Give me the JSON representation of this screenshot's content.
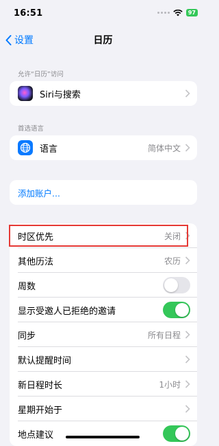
{
  "status": {
    "time": "16:51",
    "battery": "97",
    "battery_color": "#34c759"
  },
  "nav": {
    "back_label": "设置",
    "title": "日历",
    "accent": "#007aff"
  },
  "section_allow": {
    "header": "允许“日历”访问",
    "siri_label": "Siri与搜索"
  },
  "section_language": {
    "header": "首选语言",
    "language_label": "语言",
    "language_value": "简体中文"
  },
  "accounts": {
    "add_label": "添加账户..."
  },
  "settings": {
    "timezone": {
      "label": "时区优先",
      "value": "关闭"
    },
    "alt_calendar": {
      "label": "其他历法",
      "value": "农历"
    },
    "week_numbers": {
      "label": "周数",
      "toggle": false
    },
    "show_declined": {
      "label": "显示受邀人已拒绝的邀请",
      "toggle": true
    },
    "sync": {
      "label": "同步",
      "value": "所有日程"
    },
    "default_alert": {
      "label": "默认提醒时间",
      "value": ""
    },
    "new_event_duration": {
      "label": "新日程时长",
      "value": "1小时"
    },
    "week_start": {
      "label": "星期开始于",
      "value": ""
    },
    "location_suggestions": {
      "label": "地点建议",
      "toggle": true
    }
  },
  "highlight_color": "#e53935"
}
